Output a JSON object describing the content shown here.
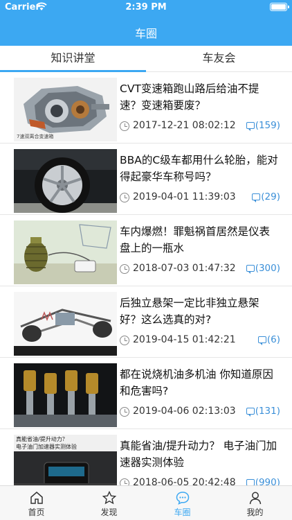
{
  "status_bar": {
    "carrier": "Carrier",
    "time": "2:39 PM"
  },
  "nav": {
    "title": "车圈"
  },
  "segments": {
    "left": "知识讲堂",
    "right": "车友会",
    "active": "left"
  },
  "articles": [
    {
      "title": "CVT变速箱跑山路后给油不提速？变速箱要废？",
      "date": "2017-12-21 08:02:12",
      "comments": "(159)",
      "image": "cvt-transmission-cutaway"
    },
    {
      "title": "BBA的C级车都用什么轮胎，能对得起豪华车称号吗？",
      "date": "2019-04-01 11:39:03",
      "comments": "(29)",
      "image": "car-wheel-tire"
    },
    {
      "title": "车内爆燃！罪魁祸首居然是仪表盘上的一瓶水",
      "date": "2018-07-03 01:47:32",
      "comments": "(300)",
      "image": "grenade-bottle-illustration"
    },
    {
      "title": "后独立悬架一定比非独立悬架好？这么选真的对?",
      "date": "2019-04-15 01:42:21",
      "comments": "(6)",
      "image": "rear-suspension-diagram"
    },
    {
      "title": "都在说烧机油多机油 你知道原因和危害吗?",
      "date": "2019-04-06 02:13:03",
      "comments": "(131)",
      "image": "engine-pistons"
    },
    {
      "title": "真能省油/提升动力？ 电子油门加速器实测体验",
      "date": "2018-06-05 20:42:48",
      "comments": "(990)",
      "image": "throttle-controller"
    }
  ],
  "thumb_text": {
    "cvt_caption": "7速双离合变速箱",
    "throttle_line1": "真能省油/提升动力？",
    "throttle_line2": "电子油门加速器实测体验"
  },
  "tabbar": [
    {
      "label": "首页",
      "icon": "home-icon",
      "active": false
    },
    {
      "label": "发现",
      "icon": "star-icon",
      "active": false
    },
    {
      "label": "车圈",
      "icon": "chat-icon",
      "active": true
    },
    {
      "label": "我的",
      "icon": "person-icon",
      "active": false
    }
  ],
  "colors": {
    "accent": "#3ca8f2",
    "comment": "#3a8fd8"
  }
}
